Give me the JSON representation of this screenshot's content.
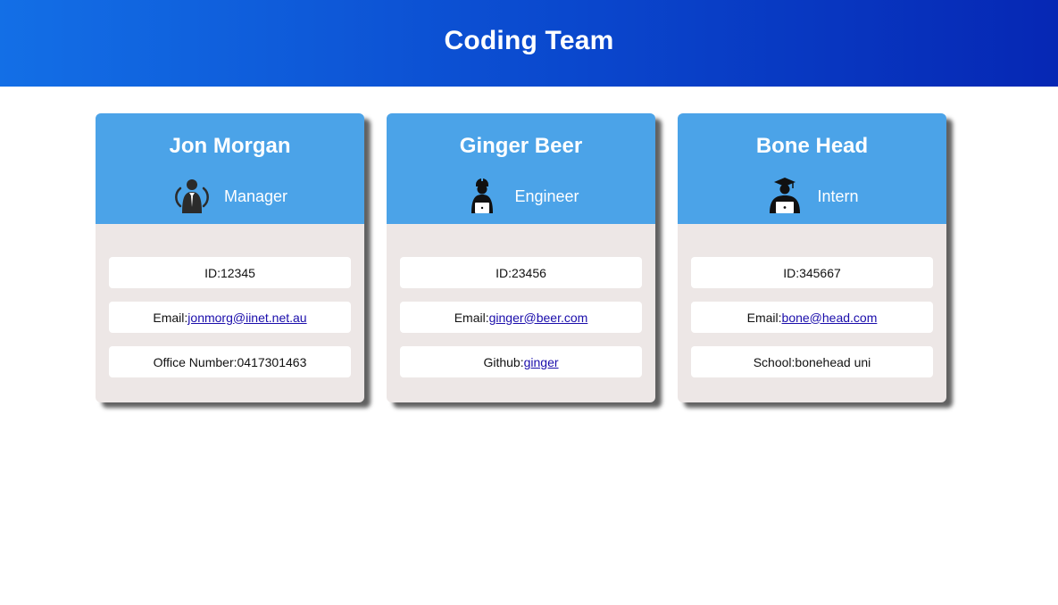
{
  "page": {
    "title": "Coding Team"
  },
  "team": [
    {
      "name": "Jon Morgan",
      "role": "Manager",
      "role_icon": "manager-icon",
      "id_label": "ID: ",
      "id": "12345",
      "email_label": "Email: ",
      "email": "jonmorg@iinet.net.au",
      "extra_label": "Office Number: ",
      "extra_value": "0417301463"
    },
    {
      "name": "Ginger Beer",
      "role": "Engineer",
      "role_icon": "engineer-icon",
      "id_label": "ID: ",
      "id": "23456",
      "email_label": "Email: ",
      "email": "ginger@beer.com",
      "extra_label": "Github: ",
      "extra_value": "ginger"
    },
    {
      "name": "Bone Head",
      "role": "Intern",
      "role_icon": "intern-icon",
      "id_label": "ID: ",
      "id": "345667",
      "email_label": "Email:",
      "email": "bone@head.com",
      "extra_label": "School: ",
      "extra_value": "bonehead uni"
    }
  ],
  "colors": {
    "header_gradient_start": "#136fe6",
    "header_gradient_end": "#0627b4",
    "card_header": "#4ba3e8",
    "card_body": "#ede7e6",
    "link": "#1a0dab"
  }
}
